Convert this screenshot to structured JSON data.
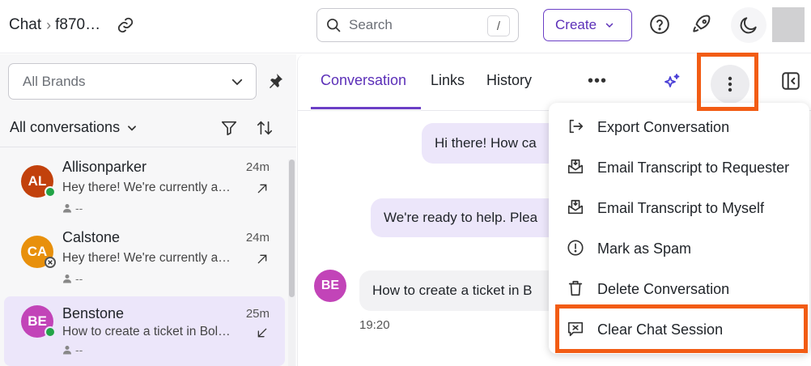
{
  "header": {
    "breadcrumb_root": "Chat",
    "breadcrumb_current": "f870…",
    "search_placeholder": "Search",
    "search_shortcut": "/",
    "create_label": "Create"
  },
  "sidebar": {
    "brand_filter": "All Brands",
    "conversation_filter": "All conversations",
    "conversations": [
      {
        "initials": "AL",
        "name": "Allisonparker",
        "time": "24m",
        "preview": "Hey there! We're currently a…",
        "assignee": "--",
        "avatar_color": "#c2410c",
        "status": "online"
      },
      {
        "initials": "CA",
        "name": "Calstone",
        "time": "24m",
        "preview": "Hey there! We're currently a…",
        "assignee": "--",
        "avatar_color": "#e8900c",
        "status": "closed"
      },
      {
        "initials": "BE",
        "name": "Benstone",
        "time": "25m",
        "preview": "How to create a ticket in Bol…",
        "assignee": "--",
        "avatar_color": "#c244b8",
        "status": "online"
      }
    ]
  },
  "main": {
    "tabs": [
      {
        "label": "Conversation",
        "active": true
      },
      {
        "label": "Links",
        "active": false
      },
      {
        "label": "History",
        "active": false
      }
    ],
    "more_label": "•••",
    "messages": [
      {
        "text": "Hi there! How ca",
        "sender": "bot"
      },
      {
        "text": "We're ready to help. Plea",
        "sender": "bot"
      },
      {
        "text": "How to create a ticket in B",
        "sender": "user",
        "initials": "BE",
        "time": "19:20"
      }
    ]
  },
  "menu": {
    "items": [
      {
        "label": "Export Conversation",
        "icon": "export-icon"
      },
      {
        "label": "Email Transcript to Requester",
        "icon": "email-transcript-icon"
      },
      {
        "label": "Email Transcript to Myself",
        "icon": "email-transcript-icon"
      },
      {
        "label": "Mark as Spam",
        "icon": "spam-icon"
      },
      {
        "label": "Delete Conversation",
        "icon": "trash-icon"
      },
      {
        "label": "Clear Chat Session",
        "icon": "clear-session-icon"
      }
    ]
  },
  "colors": {
    "accent": "#6b3fc6",
    "highlight": "#f25c14",
    "bubble_bot": "#ece6fa",
    "online": "#22a447"
  }
}
